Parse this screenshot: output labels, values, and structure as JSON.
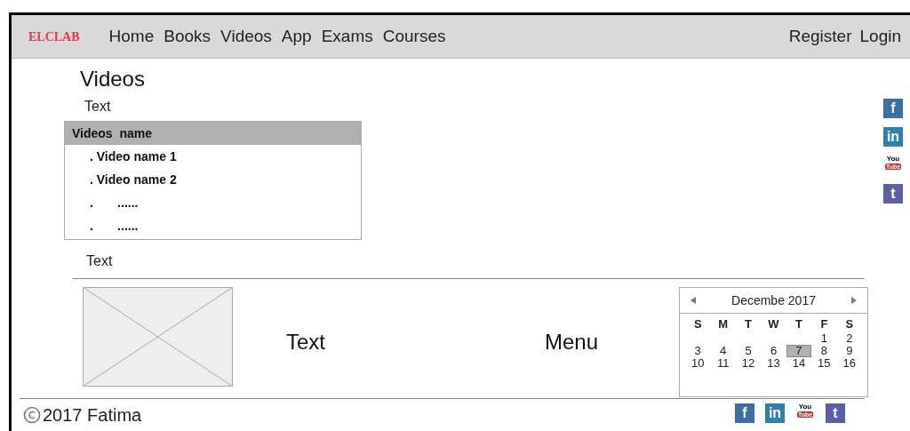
{
  "nav": {
    "logo": "ELCLAB",
    "links": [
      "Home",
      "Books",
      "Videos",
      "App",
      "Exams",
      "Courses"
    ],
    "right_links": [
      "Register",
      "Login"
    ]
  },
  "page_title": "Videos",
  "intro_text": "Text",
  "video_list": {
    "header": "Videos  name",
    "items": [
      ". Video name 1",
      ". Video name 2",
      ".       ......",
      ".       ......"
    ]
  },
  "after_text": "Text",
  "side_social": [
    {
      "kind": "facebook",
      "glyph": "f"
    },
    {
      "kind": "linkedin",
      "glyph": "in"
    },
    {
      "kind": "youtube",
      "glyph": "You",
      "glyph2": "Tube"
    },
    {
      "kind": "twitter",
      "glyph": "t"
    }
  ],
  "bottom": {
    "text": "Text",
    "menu": "Menu"
  },
  "calendar": {
    "month": "Decembe 2017",
    "weekdays": [
      "S",
      "M",
      "T",
      "W",
      "T",
      "F",
      "S"
    ],
    "weeks": [
      [
        {
          "day": "1",
          "selected": false
        },
        {
          "day": "2",
          "selected": false
        }
      ],
      [
        {
          "day": "3",
          "selected": false
        },
        {
          "day": "4",
          "selected": false
        },
        {
          "day": "5",
          "selected": false
        },
        {
          "day": "6",
          "selected": false
        },
        {
          "day": "7",
          "selected": true
        },
        {
          "day": "8",
          "selected": false
        },
        {
          "day": "9",
          "selected": false
        }
      ],
      [
        {
          "day": "10",
          "selected": false
        },
        {
          "day": "11",
          "selected": false
        },
        {
          "day": "12",
          "selected": false
        },
        {
          "day": "13",
          "selected": false
        },
        {
          "day": "14",
          "selected": false
        },
        {
          "day": "15",
          "selected": false
        },
        {
          "day": "16",
          "selected": false
        }
      ]
    ]
  },
  "footer": {
    "copyright": "2017 Fatima"
  },
  "footer_social": [
    {
      "kind": "facebook",
      "glyph": "f"
    },
    {
      "kind": "linkedin",
      "glyph": "in"
    },
    {
      "kind": "youtube",
      "glyph": "You",
      "glyph2": "Tube"
    },
    {
      "kind": "twitter",
      "glyph": "t"
    }
  ]
}
